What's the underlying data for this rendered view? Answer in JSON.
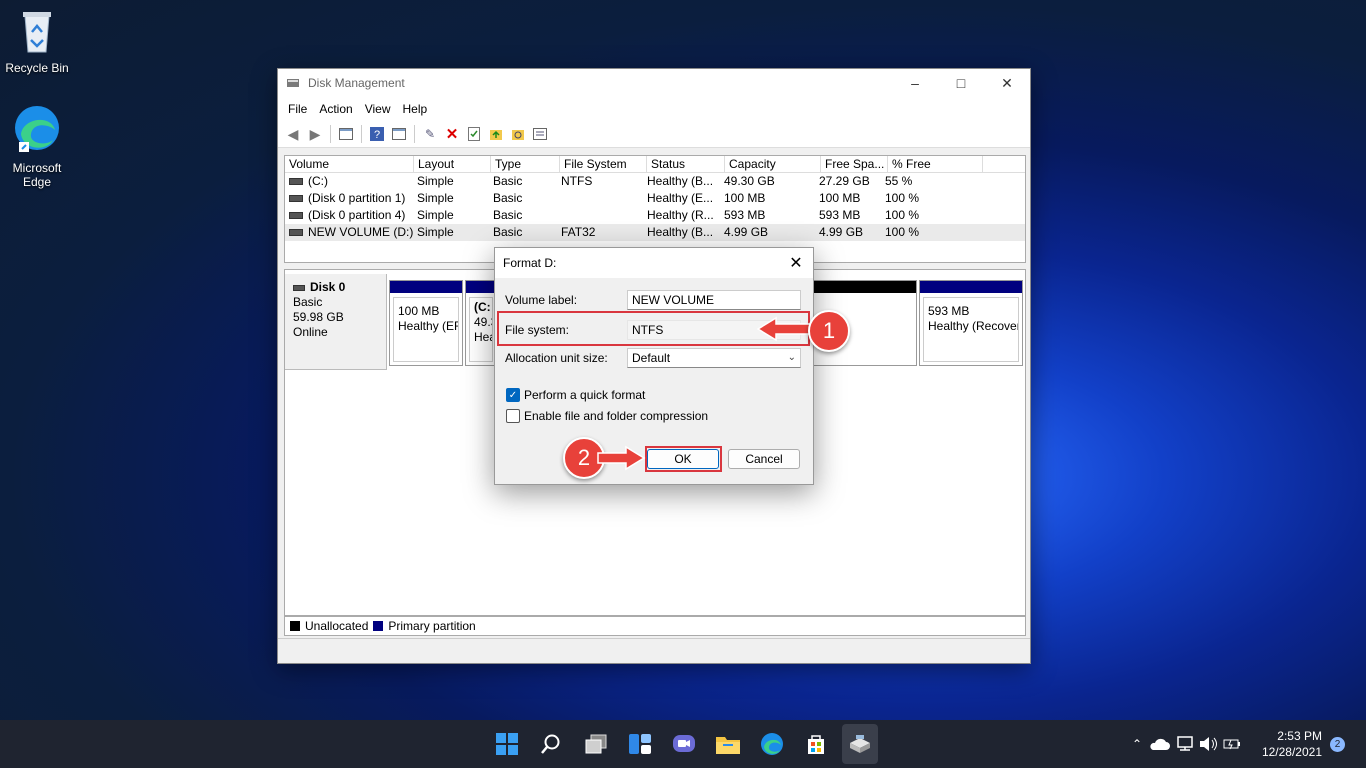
{
  "desktop": {
    "icons": [
      {
        "label": "Recycle Bin",
        "icon": "recycle-bin-icon"
      },
      {
        "label": "Microsoft Edge",
        "icon": "edge-icon"
      }
    ]
  },
  "window": {
    "title": "Disk Management",
    "menu": [
      "File",
      "Action",
      "View",
      "Help"
    ],
    "volume_list": {
      "columns": [
        "Volume",
        "Layout",
        "Type",
        "File System",
        "Status",
        "Capacity",
        "Free Spa...",
        "% Free"
      ],
      "rows": [
        [
          "(C:)",
          "Simple",
          "Basic",
          "NTFS",
          "Healthy (B...",
          "49.30 GB",
          "27.29 GB",
          "55 %"
        ],
        [
          "(Disk 0 partition 1)",
          "Simple",
          "Basic",
          "",
          "Healthy (E...",
          "100 MB",
          "100 MB",
          "100 %"
        ],
        [
          "(Disk 0 partition 4)",
          "Simple",
          "Basic",
          "",
          "Healthy (R...",
          "593 MB",
          "593 MB",
          "100 %"
        ],
        [
          "NEW VOLUME (D:)",
          "Simple",
          "Basic",
          "FAT32",
          "Healthy (B...",
          "4.99 GB",
          "4.99 GB",
          "100 %"
        ]
      ]
    },
    "disk": {
      "name": "Disk 0",
      "type": "Basic",
      "size": "59.98 GB",
      "status": "Online",
      "partitions": [
        {
          "name": "",
          "size": "100 MB",
          "status": "Healthy (EF"
        },
        {
          "name": "(C:",
          "size": "49.3",
          "status": "Heal"
        },
        {
          "name": "",
          "size": "593 MB",
          "status": "Healthy (Recover"
        }
      ]
    },
    "legend": [
      "Unallocated",
      "Primary partition"
    ],
    "colors": {
      "unallocated": "#000000",
      "primary": "#00007f"
    }
  },
  "dialog": {
    "title": "Format D:",
    "volume_label": {
      "label": "Volume label:",
      "value": "NEW VOLUME"
    },
    "file_system": {
      "label": "File system:",
      "value": "NTFS"
    },
    "allocation": {
      "label": "Allocation unit size:",
      "value": "Default"
    },
    "quick_format": {
      "label": "Perform a quick format",
      "checked": true
    },
    "compression": {
      "label": "Enable file and folder compression",
      "checked": false
    },
    "ok_label": "OK",
    "cancel_label": "Cancel"
  },
  "annotations": {
    "step1": "1",
    "step2": "2",
    "color": "#d9363e"
  },
  "taskbar": {
    "time": "2:53 PM",
    "date": "12/28/2021",
    "notification_count": "2"
  }
}
